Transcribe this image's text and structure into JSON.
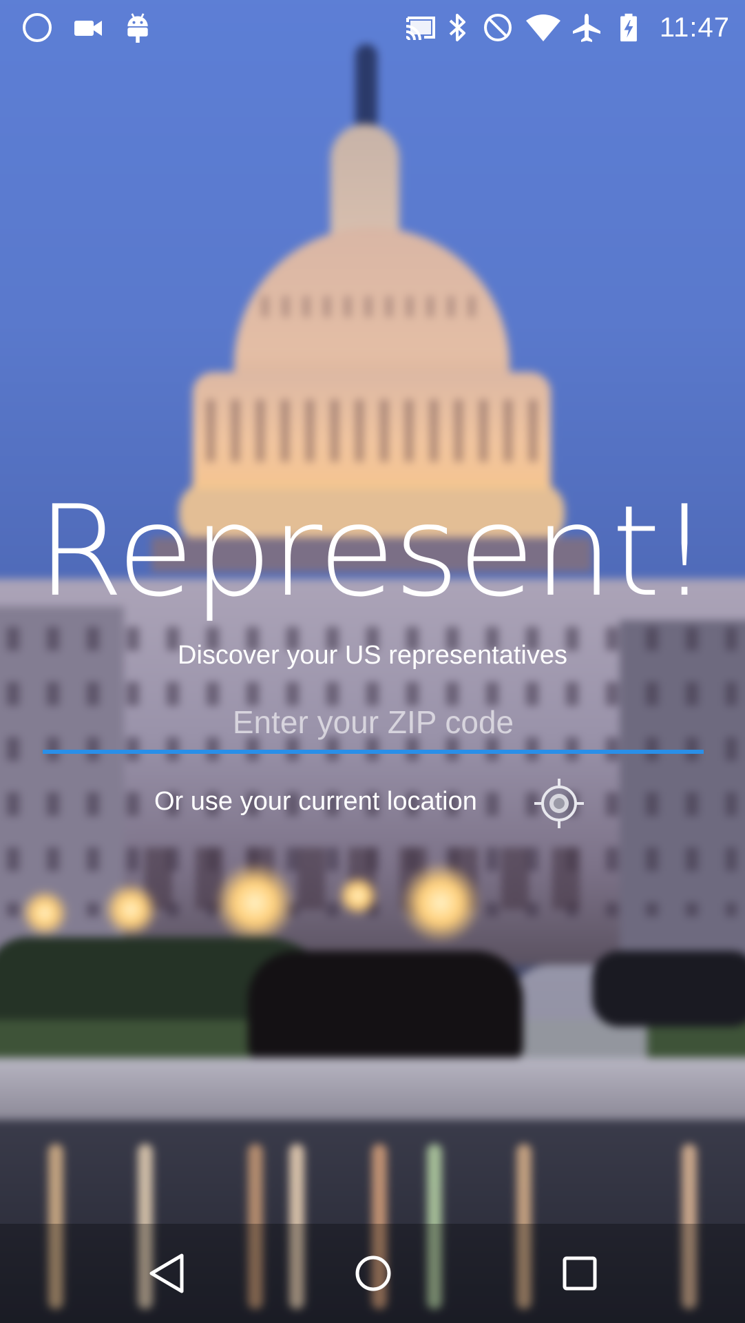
{
  "status_bar": {
    "time": "11:47",
    "left_icons": [
      "circle-icon",
      "video-camera-icon",
      "android-debug-icon"
    ],
    "right_icons": [
      "cast-icon",
      "bluetooth-icon",
      "do-not-disturb-icon",
      "wifi-icon",
      "airplane-mode-icon",
      "battery-charging-icon"
    ]
  },
  "main": {
    "title": "Represent!",
    "subtitle": "Discover your US representatives",
    "zip_input": {
      "placeholder": "Enter your ZIP code",
      "value": ""
    },
    "location_label": "Or use your current location",
    "location_icon": "my-location-icon"
  },
  "nav_bar": {
    "buttons": [
      "back-icon",
      "home-icon",
      "recents-icon"
    ]
  },
  "colors": {
    "accent": "#2A8FE8",
    "text": "#FFFFFF"
  }
}
